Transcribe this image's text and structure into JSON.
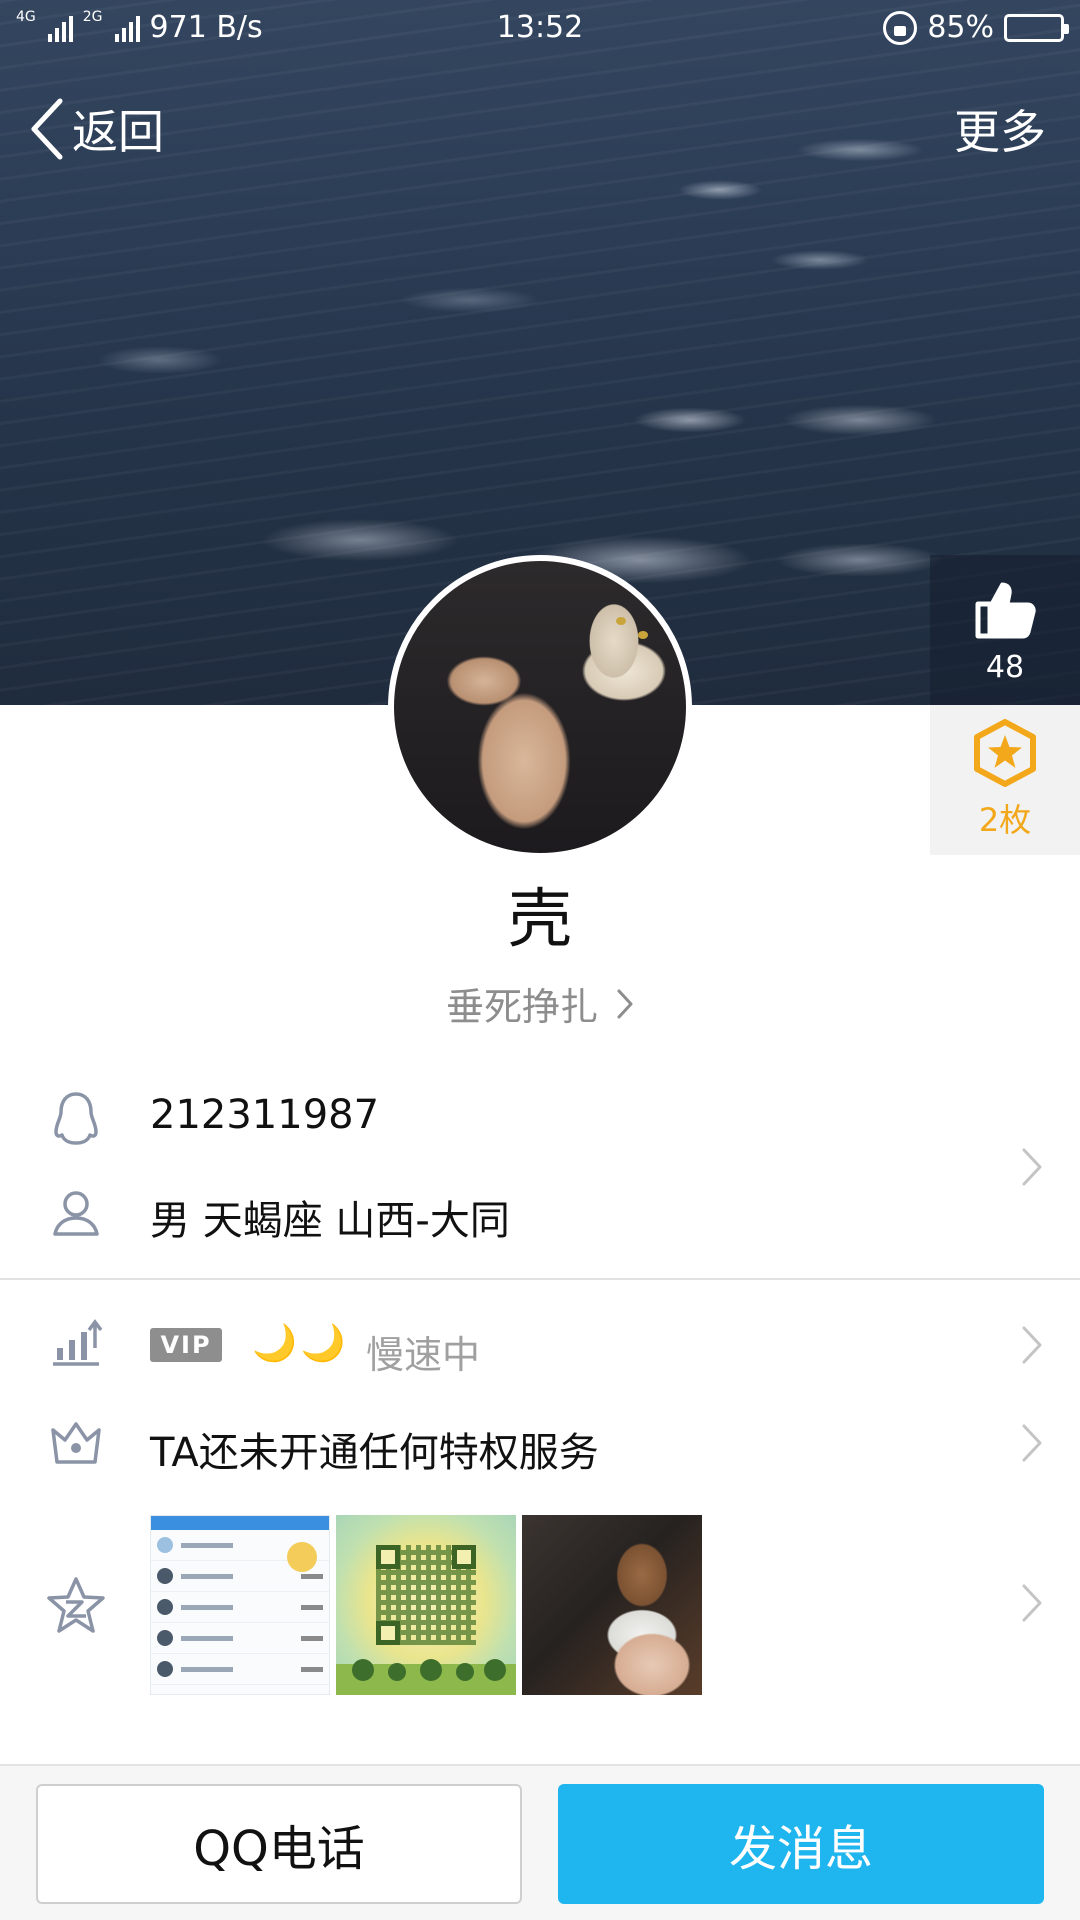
{
  "status_bar": {
    "net_tag_1": "4G",
    "net_tag_2": "2G",
    "net_speed": "971 B/s",
    "time": "13:52",
    "battery": "85%",
    "battery_level": 0.85
  },
  "nav": {
    "back_label": "返回",
    "more_label": "更多"
  },
  "side": {
    "like_count": "48",
    "medal_count": "2枚"
  },
  "profile": {
    "nickname": "壳",
    "signature": "垂死挣扎"
  },
  "info": {
    "qq_number": "212311987",
    "details": "男  天蝎座  山西-大同"
  },
  "vip": {
    "badge": "VIP",
    "moons": "🌙🌙",
    "status": "慢速中"
  },
  "privilege": {
    "text": "TA还未开通任何特权服务"
  },
  "actions": {
    "call_label": "QQ电话",
    "message_label": "发消息"
  },
  "colors": {
    "accent": "#1fb6f0",
    "medal": "#f3a81c",
    "moon": "#f5b21f"
  }
}
